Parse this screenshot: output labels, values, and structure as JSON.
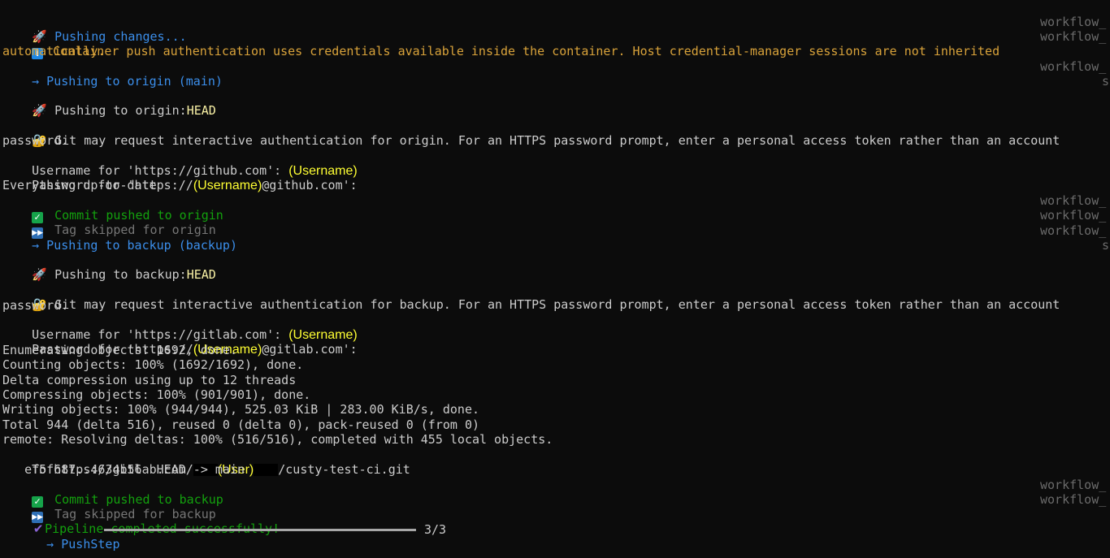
{
  "lines": {
    "l1": "Pushing changes...",
    "l2a": "Container push authentication uses credentials available inside the container. Host credential-manager sessions are not inherited",
    "l2b": "automatically.",
    "l3_prefix": "→ Pushing to origin ",
    "l3_branch": "(main)",
    "l4_text": "Pushing to origin:",
    "l4_ref": "HEAD",
    "l5a": "Git may request interactive authentication for origin. For an HTTPS password prompt, enter a personal access token rather than an account",
    "l5b": "password.",
    "l6_prefix": "Username for 'https://github.com': ",
    "l7_prefix": "Password for 'https://",
    "l7_suffix": "@github.com':",
    "l8": "Everything up-to-date",
    "l9": "Commit pushed to origin",
    "l10": "Tag skipped for origin",
    "l11_prefix": "→ Pushing to backup ",
    "l11_branch": "(backup)",
    "l12_text": "Pushing to backup:",
    "l12_ref": "HEAD",
    "l13a": "Git may request interactive authentication for backup. For an HTTPS password prompt, enter a personal access token rather than an account",
    "l13b": "password.",
    "l14_prefix": "Username for 'https://gitlab.com': ",
    "l15_prefix": "Password for 'https://",
    "l15_suffix": "@gitlab.com':",
    "l16": "Enumerating objects: 1692, done.",
    "l17": "Counting objects: 100% (1692/1692), done.",
    "l18": "Delta compression using up to 12 threads",
    "l19": "Compressing objects: 100% (901/901), done.",
    "l20": "Writing objects: 100% (944/944), 525.03 KiB | 283.00 KiB/s, done.",
    "l21": "Total 944 (delta 516), reused 0 (delta 0), pack-reused 0 (from 0)",
    "l22": "remote: Resolving deltas: 100% (516/516), completed with 455 local objects.",
    "l23_prefix": "To https://gitlab.com/",
    "l23_user": "(User)",
    "l23_suffix": "/custy-test-ci.git",
    "l24": "   ef5f687..4634b56  HEAD -> main",
    "l25": "Commit pushed to backup",
    "l26": "Tag skipped for backup",
    "l27": "Pipeline completed successfully!",
    "l28_step": "  → PushStep",
    "l28_count": "3/3"
  },
  "placeholders": {
    "username": "(Username)"
  },
  "right_labels": {
    "workflow": "workflow_",
    "s": "s"
  },
  "progress": {
    "fraction": 1.0
  },
  "colors": {
    "background": "#0c0c0c",
    "text": "#cccccc",
    "blue": "#3b8eea",
    "orange": "#d8a23a",
    "green": "#13a10e",
    "gray": "#767676",
    "highlight": "#ffff33"
  },
  "icons": {
    "rocket": "rocket-icon",
    "info": "info-icon",
    "lock": "lock-icon",
    "check": "check-icon",
    "skip": "skip-forward-icon",
    "tick": "tick-icon"
  }
}
